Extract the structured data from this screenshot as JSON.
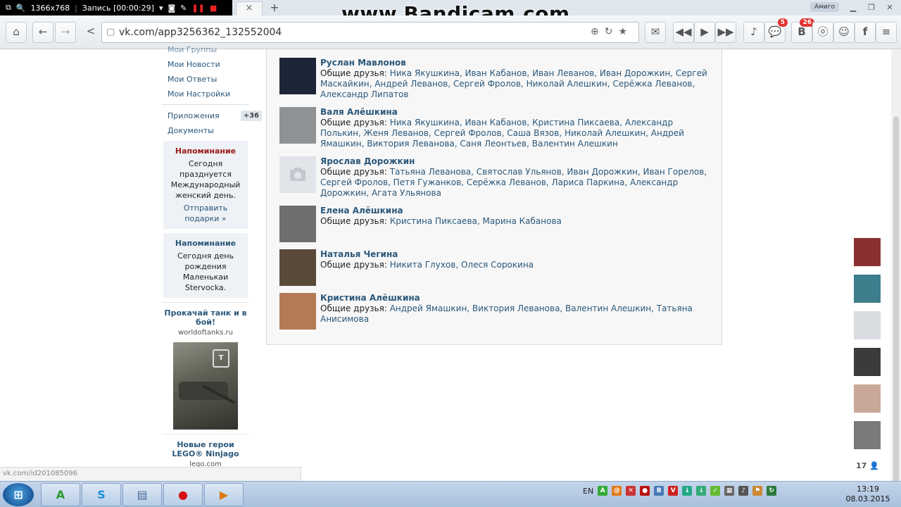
{
  "recorder": {
    "resolution": "1366x768",
    "status": "Запись [00:00:29]"
  },
  "watermark": "www.Bandicam.com",
  "window": {
    "browser_name": "Амиго"
  },
  "toolbar": {
    "url": "vk.com/app3256362_132552004",
    "messages_badge": "5",
    "vk_badge": "26"
  },
  "sidebar": {
    "links": [
      {
        "label": "Мои Группы"
      },
      {
        "label": "Мои Новости"
      },
      {
        "label": "Мои Ответы"
      },
      {
        "label": "Мои Настройки"
      }
    ],
    "apps_label": "Приложения",
    "apps_counter": "+36",
    "docs_label": "Документы",
    "reminders": [
      {
        "title": "Напоминание",
        "text": "Сегодня празднуется Международный женский день.",
        "link": "Отправить подарки »"
      },
      {
        "title": "Напоминание",
        "text": "Сегодня день рождения Маленькаи Stervocka."
      }
    ],
    "ads": [
      {
        "title": "Прокачай танк и в бой!",
        "domain": "worldoftanks.ru"
      },
      {
        "title": "Новые герои LEGO® Ninjago",
        "domain": "lego.com"
      }
    ]
  },
  "status_url": "vk.com/id201085096",
  "friends_label": "Общие друзья:",
  "friends": [
    {
      "name": "Руслан Мавлонов",
      "mutual": "Ника Якушкина, Иван Кабанов, Иван Леванов, Иван Дорожкин, Сергей Маскайкин, Андрей Леванов, Сергей Фролов, Николай Алешкин, Серёжка Леванов, Александр Липатов",
      "avatar_color": "#1d2538"
    },
    {
      "name": "Валя Алёшкина",
      "mutual": "Ника Якушкина, Иван Кабанов, Кристина Пиксаева, Александр Полькин, Женя Леванов, Сергей Фролов, Саша Вязов, Николай Алешкин, Андрей Ямашкин, Виктория Леванова, Саня Леонтьев, Валентин Алешкин",
      "avatar_color": "#8f9294"
    },
    {
      "name": "Ярослав Дорожкин",
      "mutual": "Татьяна Леванова, Святослав Ульянов, Иван Дорожкин, Иван Горелов, Сергей Фролов, Петя Гужанков, Серёжка Леванов, Лариса Паркина, Александр Дорожкин, Агата Ульянова",
      "avatar_color": "#e1e4e8"
    },
    {
      "name": "Елена Алёшкина",
      "mutual": "Кристина Пиксаева, Марина Кабанова",
      "avatar_color": "#6e6e6e"
    },
    {
      "name": "Наталья Чегина",
      "mutual": "Никита Глухов, Олеся Сорокина",
      "avatar_color": "#5a4a3a"
    },
    {
      "name": "Кристина Алёшкина",
      "mutual": "Андрей Ямашкин, Виктория Леванова, Валентин Алешкин, Татьяна Анисимова",
      "avatar_color": "#b47a55"
    }
  ],
  "right_panel": {
    "friend_colors": [
      "#8a3030",
      "#3e7d8c",
      "#d9dce0",
      "#3b3b3b",
      "#c9a89a",
      "#7a7a7a"
    ],
    "online_count": "17"
  },
  "taskbar": {
    "language": "EN",
    "time": "13:19",
    "date": "08.03.2015"
  }
}
